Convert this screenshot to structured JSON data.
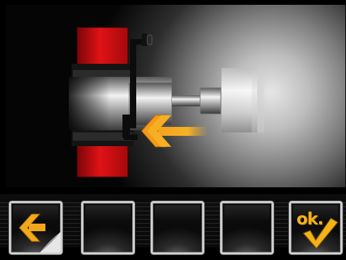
{
  "screen": {
    "illustration": {
      "icon": "wheel-clamp-mount-illustration",
      "arrow_icon": "arrow-left-icon",
      "colors": {
        "flange": "#d90f12",
        "arrow": "#f2a81d",
        "background": "#000000"
      }
    },
    "toolbar": {
      "buttons": [
        {
          "id": "back",
          "icon": "page-back-arrow-icon",
          "label": ""
        },
        {
          "id": "slot2",
          "label": ""
        },
        {
          "id": "slot3",
          "label": ""
        },
        {
          "id": "slot4",
          "label": ""
        },
        {
          "id": "ok",
          "label": "ok.",
          "icon": "checkmark-icon"
        }
      ],
      "accent_color": "#f3b21a"
    }
  }
}
